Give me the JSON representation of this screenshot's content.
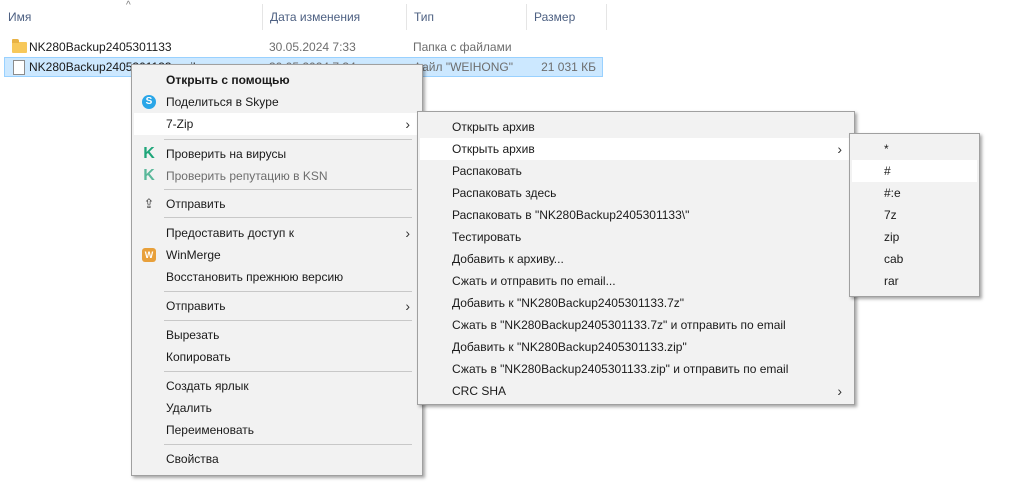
{
  "columns": {
    "name": "Имя",
    "date": "Дата изменения",
    "type": "Тип",
    "size": "Размер"
  },
  "files": [
    {
      "name": "NK280Backup2405301133",
      "date": "30.05.2024 7:33",
      "type": "Папка с файлами",
      "size": "",
      "icon": "folder-icon"
    },
    {
      "name": "NK280Backup2405301133.weihong",
      "date": "30.05.2024 7:34",
      "type": "Файл \"WEIHONG\"",
      "size": "21 031 КБ",
      "icon": "file-icon"
    }
  ],
  "context_menu": {
    "open_with": "Открыть с помощью",
    "share_skype": "Поделиться в Skype",
    "seven_zip": "7-Zip",
    "scan_virus": "Проверить на вирусы",
    "check_ksn": "Проверить репутацию в KSN",
    "send": "Отправить",
    "grant_access": "Предоставить доступ к",
    "winmerge": "WinMerge",
    "restore_version": "Восстановить прежнюю версию",
    "send_to": "Отправить",
    "cut": "Вырезать",
    "copy": "Копировать",
    "create_shortcut": "Создать ярлык",
    "delete": "Удалить",
    "rename": "Переименовать",
    "properties": "Свойства"
  },
  "zip_menu": {
    "items": [
      "Открыть архив",
      "Открыть архив",
      "Распаковать",
      "Распаковать здесь",
      "Распаковать в \"NK280Backup2405301133\\\"",
      "Тестировать",
      "Добавить к архиву...",
      "Сжать и отправить по email...",
      "Добавить к \"NK280Backup2405301133.7z\"",
      "Сжать в \"NK280Backup2405301133.7z\" и отправить по email",
      "Добавить к \"NK280Backup2405301133.zip\"",
      "Сжать в \"NK280Backup2405301133.zip\" и отправить по email",
      "CRC SHA"
    ]
  },
  "open_archive_menu": {
    "items": [
      "*",
      "#",
      "#:e",
      "7z",
      "zip",
      "cab",
      "rar"
    ]
  },
  "icons": {
    "arrow": "›",
    "sort": "^"
  }
}
